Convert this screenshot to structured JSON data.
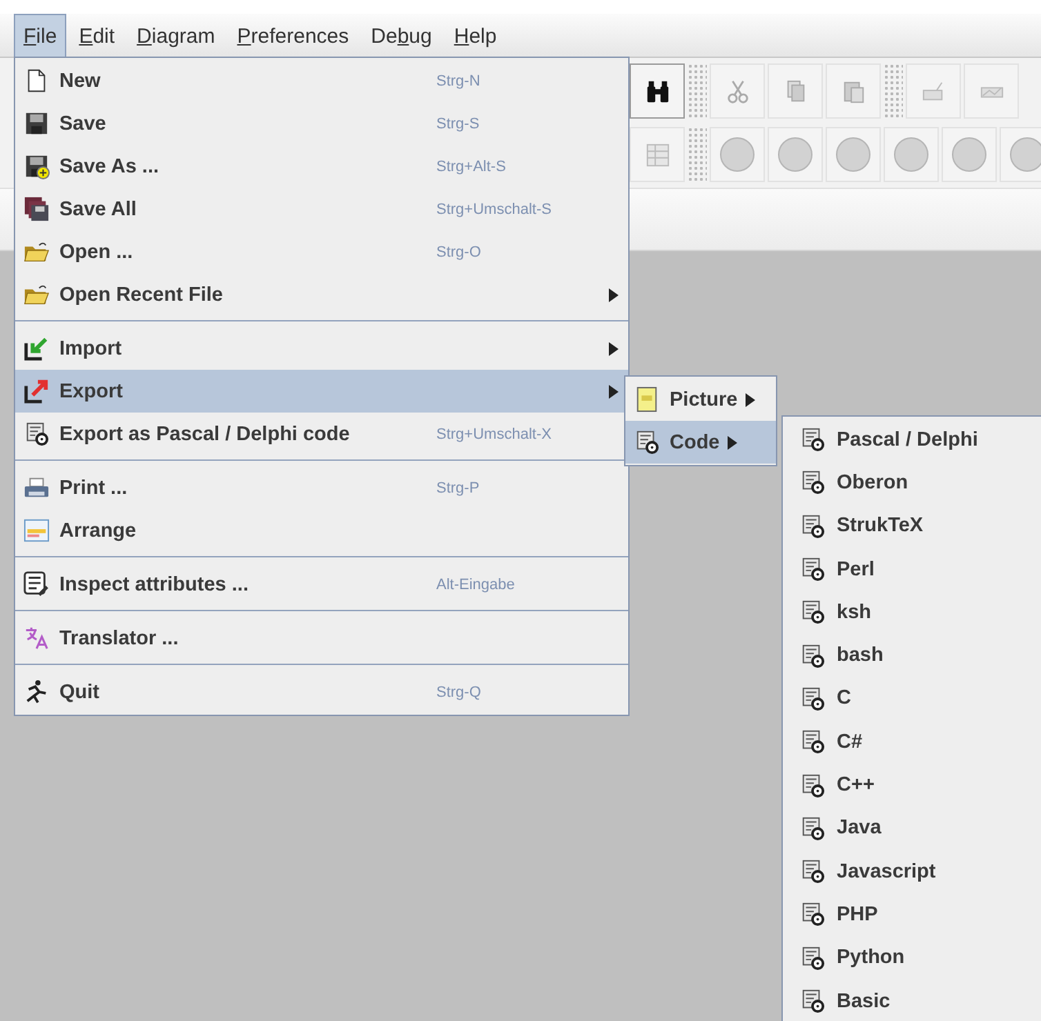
{
  "menubar": [
    {
      "mnemonic": "F",
      "after": "ile",
      "selected": true
    },
    {
      "mnemonic": "E",
      "after": "dit",
      "selected": false
    },
    {
      "mnemonic": "D",
      "after": "iagram",
      "selected": false
    },
    {
      "mnemonic": "P",
      "after": "references",
      "selected": false
    },
    {
      "before": "De",
      "mnemonic": "b",
      "after": "ug",
      "selected": false
    },
    {
      "mnemonic": "H",
      "after": "elp",
      "selected": false
    }
  ],
  "file_menu": {
    "items": [
      {
        "kind": "item",
        "label": "New",
        "shortcut": "Strg-N",
        "submenu": false,
        "selected": false
      },
      {
        "kind": "item",
        "label": "Save",
        "shortcut": "Strg-S",
        "submenu": false,
        "selected": false
      },
      {
        "kind": "item",
        "label": "Save As ...",
        "shortcut": "Strg+Alt-S",
        "submenu": false,
        "selected": false
      },
      {
        "kind": "item",
        "label": "Save All",
        "shortcut": "Strg+Umschalt-S",
        "submenu": false,
        "selected": false
      },
      {
        "kind": "item",
        "label": "Open ...",
        "shortcut": "Strg-O",
        "submenu": false,
        "selected": false
      },
      {
        "kind": "item",
        "label": "Open Recent File",
        "submenu": true,
        "selected": false
      },
      {
        "kind": "separator"
      },
      {
        "kind": "item",
        "label": "Import",
        "submenu": true,
        "selected": false
      },
      {
        "kind": "item",
        "label": "Export",
        "submenu": true,
        "selected": true
      },
      {
        "kind": "item",
        "label": "Export as Pascal / Delphi code",
        "shortcut": "Strg+Umschalt-X",
        "submenu": false,
        "selected": false
      },
      {
        "kind": "separator"
      },
      {
        "kind": "item",
        "label": "Print ...",
        "shortcut": "Strg-P",
        "submenu": false,
        "selected": false
      },
      {
        "kind": "item",
        "label": "Arrange",
        "submenu": false,
        "selected": false
      },
      {
        "kind": "separator"
      },
      {
        "kind": "item",
        "label": "Inspect attributes ...",
        "shortcut": "Alt-Eingabe",
        "submenu": false,
        "selected": false
      },
      {
        "kind": "separator"
      },
      {
        "kind": "item",
        "label": "Translator ...",
        "submenu": false,
        "selected": false
      },
      {
        "kind": "separator"
      },
      {
        "kind": "item",
        "label": "Quit",
        "shortcut": "Strg-Q",
        "submenu": false,
        "selected": false
      }
    ]
  },
  "export_submenu": {
    "items": [
      {
        "label": "Picture",
        "submenu": true,
        "selected": false
      },
      {
        "label": "Code",
        "submenu": true,
        "selected": true
      }
    ]
  },
  "code_submenu": {
    "items": [
      {
        "label": "Pascal / Delphi"
      },
      {
        "label": "Oberon"
      },
      {
        "label": "StrukTeX"
      },
      {
        "label": "Perl"
      },
      {
        "label": "ksh"
      },
      {
        "label": "bash"
      },
      {
        "label": "C"
      },
      {
        "label": "C#"
      },
      {
        "label": "C++"
      },
      {
        "label": "Java"
      },
      {
        "label": "Javascript"
      },
      {
        "label": "PHP"
      },
      {
        "label": "Python"
      },
      {
        "label": "Basic"
      }
    ]
  }
}
